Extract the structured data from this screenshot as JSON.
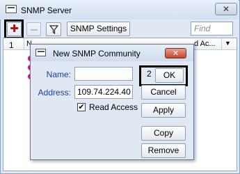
{
  "main_window": {
    "title": "SNMP Server",
    "close_glyph": "✕",
    "icon": "window-icon"
  },
  "toolbar": {
    "add_icon": "plus-icon",
    "add_glyph": "✚",
    "remove_icon": "minus-icon",
    "filter_icon": "filter-icon",
    "settings_label": "SNMP Settings",
    "find_placeholder": "Find",
    "highlight_color": "#000000"
  },
  "list": {
    "annotation": "1",
    "header_visible_fragments": [
      "N",
      "d Ac..."
    ],
    "dropdown_glyph": "▼",
    "row_icon_color": "#c0208a",
    "rows_visible": 3
  },
  "dialog": {
    "title": "New SNMP Community",
    "close_glyph": "✕",
    "fields": {
      "name_label": "Name:",
      "name_value": "",
      "address_label": "Address:",
      "address_value": "109.74.224.40"
    },
    "read_access": {
      "label": "Read Access",
      "checked": true,
      "glyph": "✔"
    },
    "buttons": {
      "ok_annotation": "2",
      "ok_label": "OK",
      "cancel_label": "Cancel",
      "apply_label": "Apply",
      "copy_label": "Copy",
      "remove_label": "Remove"
    }
  }
}
